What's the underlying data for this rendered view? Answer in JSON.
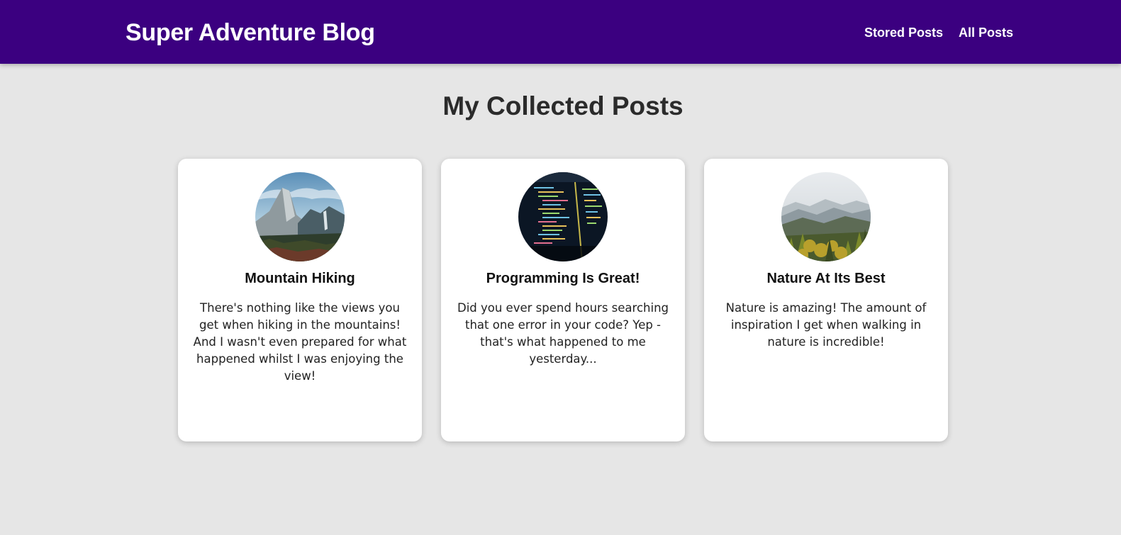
{
  "header": {
    "logo": "Super Adventure Blog",
    "nav": [
      {
        "label": "Stored Posts"
      },
      {
        "label": "All Posts"
      }
    ]
  },
  "colors": {
    "header_bg": "#3b0080",
    "page_bg": "#e6e6e6",
    "card_bg": "#ffffff"
  },
  "main": {
    "title": "My Collected Posts",
    "posts": [
      {
        "title": "Mountain Hiking",
        "summary": "There's nothing like the views you get when hiking in the mountains! And I wasn't even prepared for what happened whilst I was enjoying the view!",
        "image": "mountain-valley-photo"
      },
      {
        "title": "Programming Is Great!",
        "summary": "Did you ever spend hours searching that one error in your code? Yep - that's what happened to me yesterday...",
        "image": "code-screen-photo"
      },
      {
        "title": "Nature At Its Best",
        "summary": "Nature is amazing! The amount of inspiration I get when walking in nature is incredible!",
        "image": "misty-forest-photo"
      }
    ]
  }
}
